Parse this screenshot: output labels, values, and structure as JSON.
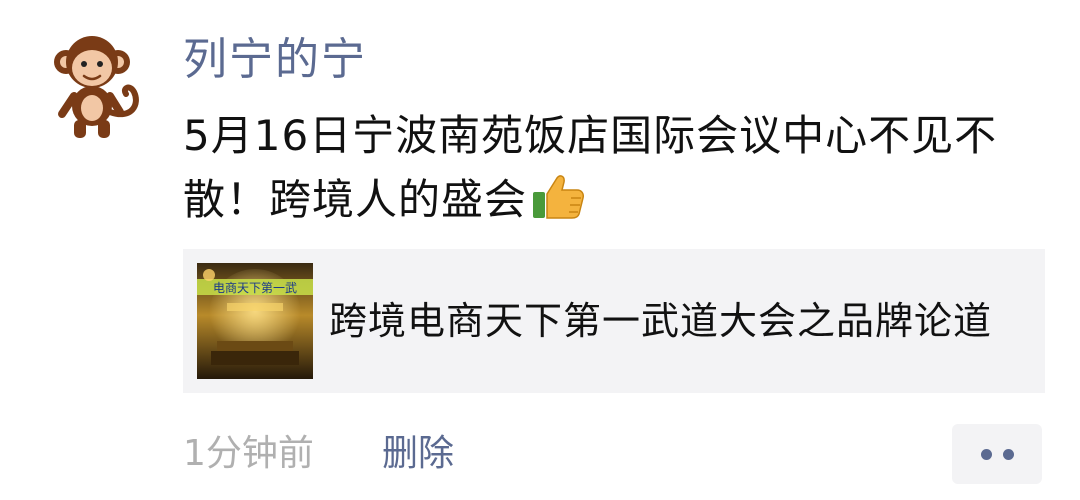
{
  "post": {
    "author": "列宁的宁",
    "avatar_icon": "monkey-avatar",
    "text": "5月16日宁波南苑饭店国际会议中心不见不散！跨境人的盛会",
    "emoji_icon": "thumbs-up-icon",
    "link": {
      "title": "跨境电商天下第一武道大会之品牌论道",
      "thumb_caption": "电商天下第一武"
    },
    "time": "1分钟前",
    "delete_label": "删除",
    "more_icon": "more-dots-icon"
  },
  "colors": {
    "name_blue": "#5b6a91",
    "text": "#111111",
    "muted": "#b0b0b0",
    "card_bg": "#f3f3f5"
  }
}
